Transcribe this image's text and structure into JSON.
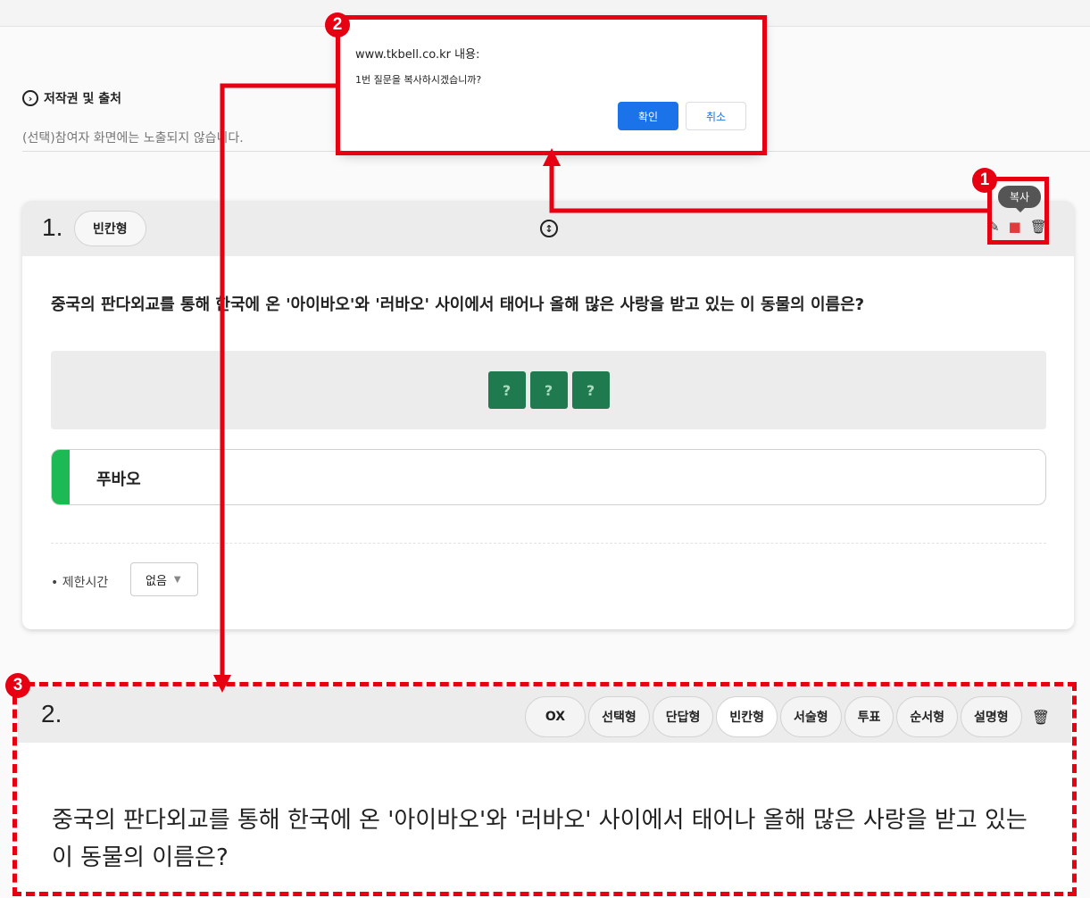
{
  "copyright": {
    "title": "저작권 및 출처",
    "note": "(선택)참여자 화면에는 노출되지 않습니다."
  },
  "question1": {
    "number": "1.",
    "type_label": "빈칸형",
    "move_icon": "↕",
    "tools": {
      "edit_icon": "✎",
      "copy_icon": "■",
      "delete_icon": "🗑"
    },
    "text": "중국의 판다외교를 통해 한국에 온 '아이바오'와 '러바오' 사이에서 태어나 올해 많은 사랑을 받고 있는 이 동물의 이름은?",
    "blanks": [
      "?",
      "?",
      "?"
    ],
    "answer": "푸바오",
    "time_limit_label": "• 제한시간",
    "time_limit_value": "없음",
    "time_limit_arrow": "▼"
  },
  "tooltip": "복사",
  "dialog": {
    "origin": "www.tkbell.co.kr 내용:",
    "message": "1번 질문을 복사하시겠습니까?",
    "ok": "확인",
    "cancel": "취소"
  },
  "question2": {
    "number": "2.",
    "types": [
      "OX",
      "선택형",
      "단답형",
      "빈칸형",
      "서술형",
      "투표",
      "순서형",
      "설명형"
    ],
    "selected_type": "빈칸형",
    "delete_icon": "🗑",
    "text": "중국의 판다외교를 통해 한국에 온 '아이바오'와 '러바오' 사이에서 태어나 올해 많은 사랑을 받고 있는 이 동물의 이름은?"
  },
  "annotations": {
    "badges": [
      "1",
      "2",
      "3"
    ],
    "color": "#e60012"
  }
}
